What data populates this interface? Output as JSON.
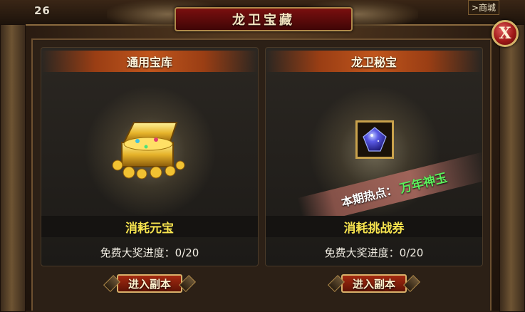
{
  "top_bar": {
    "left_number": "26",
    "shop_link": ">商城"
  },
  "window": {
    "title": "龙卫宝藏",
    "close_label": "X"
  },
  "panels": [
    {
      "header": "通用宝库",
      "icon": "treasure-chest-icon",
      "cost": "消耗元宝",
      "progress": "免费大奖进度：0/20",
      "button": "进入副本"
    },
    {
      "header": "龙卫秘宝",
      "icon": "blue-gem-icon",
      "hot_label": "本期热点：",
      "hot_value": "万年神玉",
      "cost": "消耗挑战券",
      "progress": "免费大奖进度：0/20",
      "button": "进入副本"
    }
  ],
  "colors": {
    "cost_text": "#f6e34e",
    "hot_value": "#5cf05c",
    "title_plate": "#7a0f0f"
  }
}
